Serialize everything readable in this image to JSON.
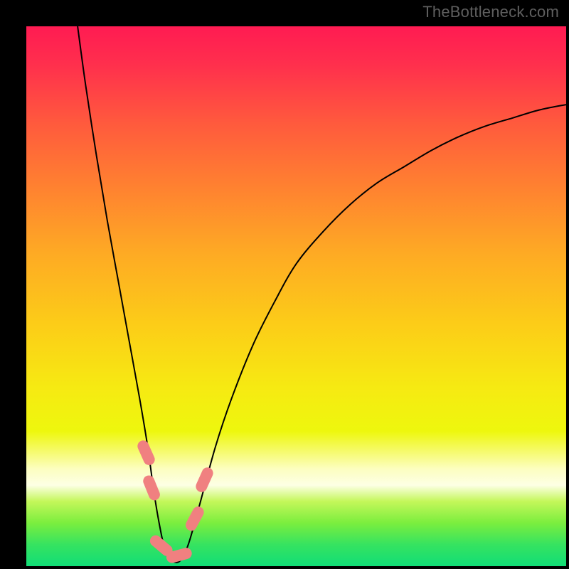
{
  "watermark": "TheBottleneck.com",
  "chart_data": {
    "type": "line",
    "title": "",
    "xlabel": "",
    "ylabel": "",
    "xlim": [
      0,
      100
    ],
    "ylim": [
      0,
      100
    ],
    "background_gradient": {
      "stops": [
        {
          "pos": 0.0,
          "color": "#ff1b52"
        },
        {
          "pos": 0.07,
          "color": "#ff2f4d"
        },
        {
          "pos": 0.18,
          "color": "#ff5a3d"
        },
        {
          "pos": 0.3,
          "color": "#ff8230"
        },
        {
          "pos": 0.42,
          "color": "#feaa24"
        },
        {
          "pos": 0.55,
          "color": "#fccc18"
        },
        {
          "pos": 0.67,
          "color": "#f6ea12"
        },
        {
          "pos": 0.75,
          "color": "#eef70d"
        },
        {
          "pos": 0.82,
          "color": "#fcfec0"
        },
        {
          "pos": 0.85,
          "color": "#fdffe5"
        },
        {
          "pos": 0.88,
          "color": "#c4f75a"
        },
        {
          "pos": 0.92,
          "color": "#7bee3e"
        },
        {
          "pos": 0.96,
          "color": "#36e360"
        },
        {
          "pos": 1.0,
          "color": "#11dd77"
        }
      ]
    },
    "series": [
      {
        "name": "curve",
        "color": "#000000",
        "stroke_width": 2,
        "x": [
          9.5,
          11,
          13,
          15,
          17,
          19,
          21,
          22.5,
          23.6,
          24.6,
          25.7,
          27,
          28.5,
          30,
          32,
          35,
          38,
          42,
          46,
          50,
          55,
          60,
          65,
          70,
          75,
          80,
          85,
          90,
          95,
          100
        ],
        "y": [
          100,
          89,
          76,
          64,
          53,
          42,
          31,
          22,
          14,
          8,
          3,
          1,
          1,
          4,
          11,
          22,
          31,
          41,
          49,
          56,
          62,
          67,
          71,
          74,
          77,
          79.5,
          81.5,
          83,
          84.5,
          85.5
        ]
      }
    ],
    "markers": {
      "color": "#f08080",
      "shape": "rounded-rect",
      "points": [
        {
          "x": 22.2,
          "y": 21.0,
          "w": 2.1,
          "h": 4.8,
          "rot": -24
        },
        {
          "x": 23.2,
          "y": 14.5,
          "w": 2.1,
          "h": 4.8,
          "rot": -22
        },
        {
          "x": 25.0,
          "y": 3.8,
          "w": 2.1,
          "h": 4.8,
          "rot": -50
        },
        {
          "x": 28.3,
          "y": 2.0,
          "w": 2.1,
          "h": 4.8,
          "rot": 75
        },
        {
          "x": 31.2,
          "y": 8.8,
          "w": 2.1,
          "h": 4.8,
          "rot": 28
        },
        {
          "x": 33.0,
          "y": 16.0,
          "w": 2.1,
          "h": 4.8,
          "rot": 24
        }
      ]
    }
  }
}
